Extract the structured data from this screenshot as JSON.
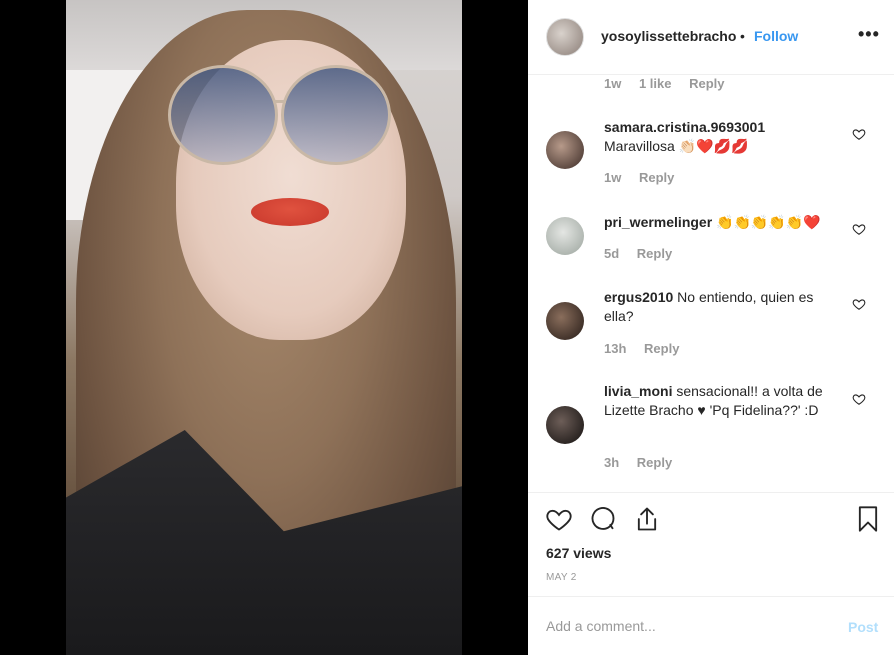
{
  "post": {
    "username": "yosoylissettebracho",
    "separator": "•",
    "follow_label": "Follow",
    "more_label": "•••"
  },
  "comments": [
    {
      "id": "prev",
      "time": "1w",
      "likes": "1 like",
      "reply": "Reply"
    },
    {
      "id": "c1",
      "user": "samara.cristina.9693001",
      "text": "Maravillosa 👏🏻❤️💋💋",
      "time": "1w",
      "reply": "Reply"
    },
    {
      "id": "c2",
      "user": "pri_wermelinger",
      "text": "👏👏👏👏👏❤️",
      "time": "5d",
      "reply": "Reply"
    },
    {
      "id": "c3",
      "user": "ergus2010",
      "text": "No entiendo, quien es ella?",
      "time": "13h",
      "reply": "Reply"
    },
    {
      "id": "c4",
      "user": "livia_moni",
      "text": "sensacional!! a volta de Lizette Bracho ♥ 'Pq Fidelina??' :D",
      "time": "3h",
      "reply": "Reply"
    }
  ],
  "stats": {
    "views": "627 views",
    "date": "MAY 2"
  },
  "add_comment": {
    "placeholder": "Add a comment...",
    "post_label": "Post"
  },
  "icons": {
    "like": "heart-icon",
    "comment": "comment-icon",
    "share": "share-icon",
    "save": "bookmark-icon",
    "comment_like": "small-heart-icon"
  },
  "colors": {
    "accent": "#3897f0",
    "post_disabled": "#b2dffc",
    "meta_gray": "#999999",
    "text": "#262626"
  }
}
